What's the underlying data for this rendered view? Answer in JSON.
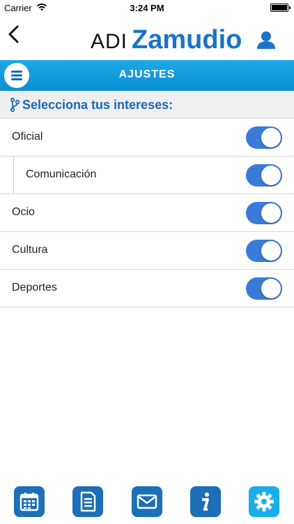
{
  "status_bar": {
    "carrier": "Carrier",
    "time": "3:24 PM"
  },
  "logo": {
    "prefix": "ADI",
    "name": "Zamudio"
  },
  "header": {
    "title": "AJUSTES"
  },
  "section": {
    "title": "Selecciona tus intereses:"
  },
  "interests": [
    {
      "label": "Oficial",
      "enabled": true
    },
    {
      "label": "Comunicación",
      "enabled": true
    },
    {
      "label": "Ocio",
      "enabled": true
    },
    {
      "label": "Cultura",
      "enabled": true
    },
    {
      "label": "Deportes",
      "enabled": true
    }
  ],
  "tabs": [
    {
      "icon": "calendar-icon",
      "active": false
    },
    {
      "icon": "document-icon",
      "active": false
    },
    {
      "icon": "mail-icon",
      "active": false
    },
    {
      "icon": "info-icon",
      "active": false
    },
    {
      "icon": "gear-icon",
      "active": true
    }
  ],
  "colors": {
    "brand": "#1a73c7",
    "accent": "#1aaeea",
    "toggle_on": "#3a7bd8"
  }
}
